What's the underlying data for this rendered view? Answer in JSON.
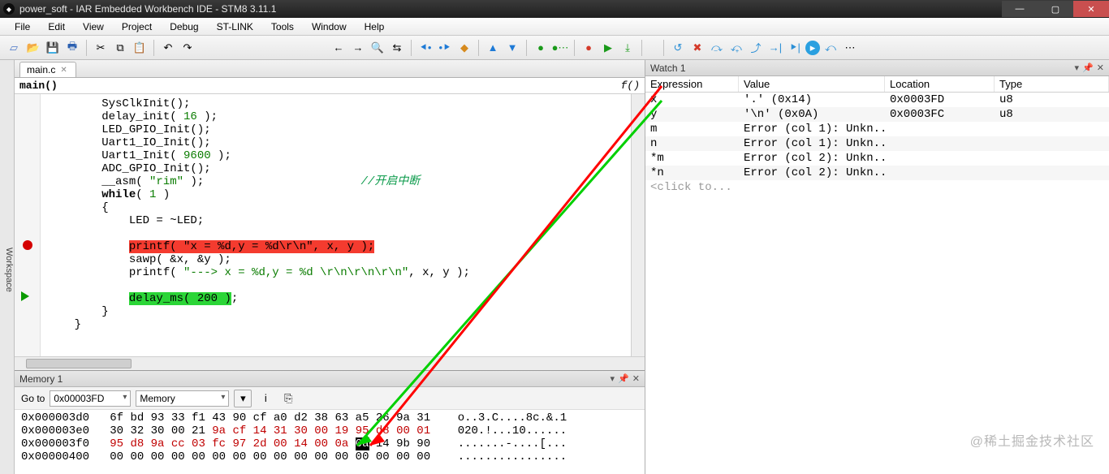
{
  "title": "power_soft - IAR Embedded Workbench IDE - STM8 3.11.1",
  "menu": [
    "File",
    "Edit",
    "View",
    "Project",
    "Debug",
    "ST-LINK",
    "Tools",
    "Window",
    "Help"
  ],
  "workspace_tab": "Workspace",
  "file_tab": "main.c",
  "function_label": "main()",
  "fx_label": "f()",
  "code": {
    "l1": "        SysClkInit();",
    "l2a": "        delay_init( ",
    "l2n": "16",
    "l2b": " );",
    "l3": "        LED_GPIO_Init();",
    "l4": "        Uart1_IO_Init();",
    "l5a": "        Uart1_Init( ",
    "l5n": "9600",
    "l5b": " );",
    "l6": "        ADC_GPIO_Init();",
    "l7a": "        __asm( ",
    "l7s": "\"rim\"",
    "l7b": " );",
    "l7c": "                       //开启中断",
    "l8a": "        ",
    "l8kw": "while",
    "l8b": "( ",
    "l8n": "1",
    "l8c": " )",
    "l9": "        {",
    "l10": "            LED = ~LED;",
    "l11": "",
    "l12a": "            ",
    "l12hl": "printf( \"x = %d,y = %d\\r\\n\", x, y );",
    "l13": "            sawp( &x, &y );",
    "l14a": "            printf( ",
    "l14s": "\"---> x = %d,y = %d \\r\\n\\r\\n\\r\\n\"",
    "l14b": ", x, y );",
    "l15": "",
    "l16a": "            ",
    "l16hl": "delay_ms( 200 )",
    "l16b": ";",
    "l17": "        }",
    "l18": "    }"
  },
  "memory": {
    "title": "Memory 1",
    "goto_label": "Go to",
    "goto_value": "0x00003FD",
    "view_value": "Memory",
    "rows": [
      {
        "addr": "0x000003d0",
        "b": "6f bd 93 33 f1 43 90 cf a0 d2 38 63 a5 26 9a 31",
        "ascii": "o..3.C....8c.&.1"
      },
      {
        "addr": "0x000003e0",
        "b_pre": "30 32 30 00 21 ",
        "b_red": "9a cf 14 31 30 00 19 95 d8 00 01",
        "ascii": "020.!...10......"
      },
      {
        "addr": "0x000003f0",
        "b_pre": "",
        "b_red": "95 d8 9a cc 03 fc 97 2d 00 14 00 0a ",
        "b_cur": "0a",
        "b_post": " 14 9b 90",
        "ascii": ".......-....[..."
      },
      {
        "addr": "0x00000400",
        "b": "00 00 00 00 00 00 00 00 00 00 00 00 00 00 00 00",
        "ascii": "................"
      }
    ]
  },
  "watch": {
    "title": "Watch 1",
    "cols": {
      "exp": "Expression",
      "val": "Value",
      "loc": "Location",
      "typ": "Type"
    },
    "rows": [
      {
        "exp": "x",
        "val": "'.' (0x14)",
        "loc": "0x0003FD",
        "typ": "u8"
      },
      {
        "exp": "y",
        "val": "'\\n' (0x0A)",
        "loc": "0x0003FC",
        "typ": "u8"
      },
      {
        "exp": "m",
        "val": "Error (col 1): Unkn...",
        "loc": "",
        "typ": ""
      },
      {
        "exp": "n",
        "val": "Error (col 1): Unkn...",
        "loc": "",
        "typ": ""
      },
      {
        "exp": "*m",
        "val": "Error (col 2): Unkn...",
        "loc": "",
        "typ": ""
      },
      {
        "exp": "*n",
        "val": "Error (col 2): Unkn...",
        "loc": "",
        "typ": ""
      }
    ],
    "placeholder": "<click to..."
  },
  "watermark": "@稀土掘金技术社区"
}
